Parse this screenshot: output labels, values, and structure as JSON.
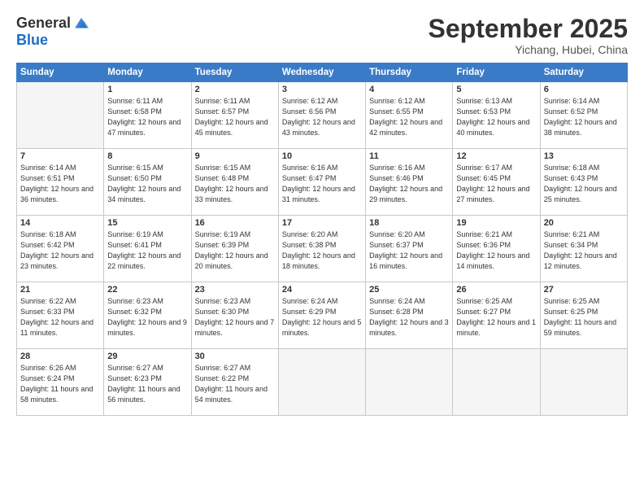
{
  "logo": {
    "text_general": "General",
    "text_blue": "Blue"
  },
  "title": "September 2025",
  "location": "Yichang, Hubei, China",
  "days_of_week": [
    "Sunday",
    "Monday",
    "Tuesday",
    "Wednesday",
    "Thursday",
    "Friday",
    "Saturday"
  ],
  "weeks": [
    [
      {
        "day": "",
        "empty": true
      },
      {
        "day": "1",
        "sunrise": "Sunrise: 6:11 AM",
        "sunset": "Sunset: 6:58 PM",
        "daylight": "Daylight: 12 hours and 47 minutes."
      },
      {
        "day": "2",
        "sunrise": "Sunrise: 6:11 AM",
        "sunset": "Sunset: 6:57 PM",
        "daylight": "Daylight: 12 hours and 45 minutes."
      },
      {
        "day": "3",
        "sunrise": "Sunrise: 6:12 AM",
        "sunset": "Sunset: 6:56 PM",
        "daylight": "Daylight: 12 hours and 43 minutes."
      },
      {
        "day": "4",
        "sunrise": "Sunrise: 6:12 AM",
        "sunset": "Sunset: 6:55 PM",
        "daylight": "Daylight: 12 hours and 42 minutes."
      },
      {
        "day": "5",
        "sunrise": "Sunrise: 6:13 AM",
        "sunset": "Sunset: 6:53 PM",
        "daylight": "Daylight: 12 hours and 40 minutes."
      },
      {
        "day": "6",
        "sunrise": "Sunrise: 6:14 AM",
        "sunset": "Sunset: 6:52 PM",
        "daylight": "Daylight: 12 hours and 38 minutes."
      }
    ],
    [
      {
        "day": "7",
        "sunrise": "Sunrise: 6:14 AM",
        "sunset": "Sunset: 6:51 PM",
        "daylight": "Daylight: 12 hours and 36 minutes."
      },
      {
        "day": "8",
        "sunrise": "Sunrise: 6:15 AM",
        "sunset": "Sunset: 6:50 PM",
        "daylight": "Daylight: 12 hours and 34 minutes."
      },
      {
        "day": "9",
        "sunrise": "Sunrise: 6:15 AM",
        "sunset": "Sunset: 6:48 PM",
        "daylight": "Daylight: 12 hours and 33 minutes."
      },
      {
        "day": "10",
        "sunrise": "Sunrise: 6:16 AM",
        "sunset": "Sunset: 6:47 PM",
        "daylight": "Daylight: 12 hours and 31 minutes."
      },
      {
        "day": "11",
        "sunrise": "Sunrise: 6:16 AM",
        "sunset": "Sunset: 6:46 PM",
        "daylight": "Daylight: 12 hours and 29 minutes."
      },
      {
        "day": "12",
        "sunrise": "Sunrise: 6:17 AM",
        "sunset": "Sunset: 6:45 PM",
        "daylight": "Daylight: 12 hours and 27 minutes."
      },
      {
        "day": "13",
        "sunrise": "Sunrise: 6:18 AM",
        "sunset": "Sunset: 6:43 PM",
        "daylight": "Daylight: 12 hours and 25 minutes."
      }
    ],
    [
      {
        "day": "14",
        "sunrise": "Sunrise: 6:18 AM",
        "sunset": "Sunset: 6:42 PM",
        "daylight": "Daylight: 12 hours and 23 minutes."
      },
      {
        "day": "15",
        "sunrise": "Sunrise: 6:19 AM",
        "sunset": "Sunset: 6:41 PM",
        "daylight": "Daylight: 12 hours and 22 minutes."
      },
      {
        "day": "16",
        "sunrise": "Sunrise: 6:19 AM",
        "sunset": "Sunset: 6:39 PM",
        "daylight": "Daylight: 12 hours and 20 minutes."
      },
      {
        "day": "17",
        "sunrise": "Sunrise: 6:20 AM",
        "sunset": "Sunset: 6:38 PM",
        "daylight": "Daylight: 12 hours and 18 minutes."
      },
      {
        "day": "18",
        "sunrise": "Sunrise: 6:20 AM",
        "sunset": "Sunset: 6:37 PM",
        "daylight": "Daylight: 12 hours and 16 minutes."
      },
      {
        "day": "19",
        "sunrise": "Sunrise: 6:21 AM",
        "sunset": "Sunset: 6:36 PM",
        "daylight": "Daylight: 12 hours and 14 minutes."
      },
      {
        "day": "20",
        "sunrise": "Sunrise: 6:21 AM",
        "sunset": "Sunset: 6:34 PM",
        "daylight": "Daylight: 12 hours and 12 minutes."
      }
    ],
    [
      {
        "day": "21",
        "sunrise": "Sunrise: 6:22 AM",
        "sunset": "Sunset: 6:33 PM",
        "daylight": "Daylight: 12 hours and 11 minutes."
      },
      {
        "day": "22",
        "sunrise": "Sunrise: 6:23 AM",
        "sunset": "Sunset: 6:32 PM",
        "daylight": "Daylight: 12 hours and 9 minutes."
      },
      {
        "day": "23",
        "sunrise": "Sunrise: 6:23 AM",
        "sunset": "Sunset: 6:30 PM",
        "daylight": "Daylight: 12 hours and 7 minutes."
      },
      {
        "day": "24",
        "sunrise": "Sunrise: 6:24 AM",
        "sunset": "Sunset: 6:29 PM",
        "daylight": "Daylight: 12 hours and 5 minutes."
      },
      {
        "day": "25",
        "sunrise": "Sunrise: 6:24 AM",
        "sunset": "Sunset: 6:28 PM",
        "daylight": "Daylight: 12 hours and 3 minutes."
      },
      {
        "day": "26",
        "sunrise": "Sunrise: 6:25 AM",
        "sunset": "Sunset: 6:27 PM",
        "daylight": "Daylight: 12 hours and 1 minute."
      },
      {
        "day": "27",
        "sunrise": "Sunrise: 6:25 AM",
        "sunset": "Sunset: 6:25 PM",
        "daylight": "Daylight: 11 hours and 59 minutes."
      }
    ],
    [
      {
        "day": "28",
        "sunrise": "Sunrise: 6:26 AM",
        "sunset": "Sunset: 6:24 PM",
        "daylight": "Daylight: 11 hours and 58 minutes."
      },
      {
        "day": "29",
        "sunrise": "Sunrise: 6:27 AM",
        "sunset": "Sunset: 6:23 PM",
        "daylight": "Daylight: 11 hours and 56 minutes."
      },
      {
        "day": "30",
        "sunrise": "Sunrise: 6:27 AM",
        "sunset": "Sunset: 6:22 PM",
        "daylight": "Daylight: 11 hours and 54 minutes."
      },
      {
        "day": "",
        "empty": true
      },
      {
        "day": "",
        "empty": true
      },
      {
        "day": "",
        "empty": true
      },
      {
        "day": "",
        "empty": true
      }
    ]
  ]
}
